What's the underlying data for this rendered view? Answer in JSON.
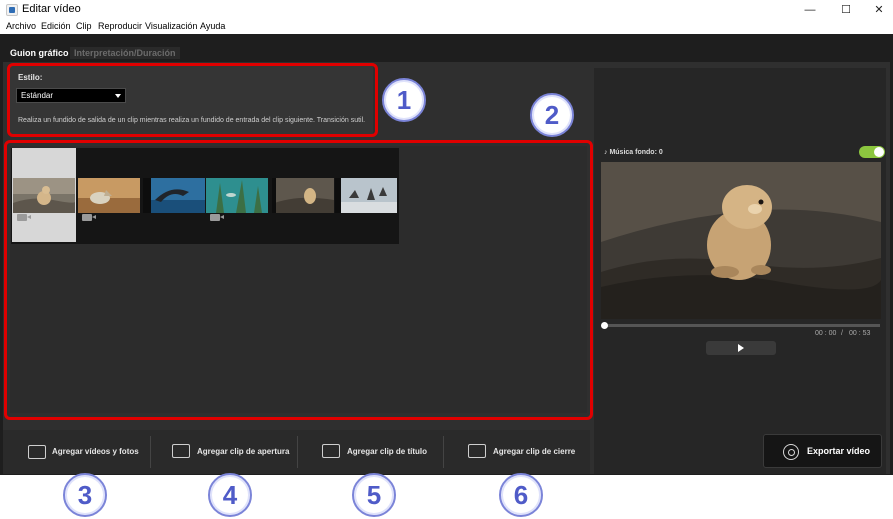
{
  "window": {
    "title": "Editar vídeo",
    "controls": [
      "minimize-icon",
      "maximize-icon",
      "close-icon"
    ]
  },
  "menu": [
    "Archivo",
    "Edición",
    "Clip",
    "Reproducir",
    "Visualización",
    "Ayuda"
  ],
  "tabs": [
    {
      "label": "Guion gráfico",
      "active": true
    },
    {
      "label": "Interpretación/Duración",
      "active": false
    }
  ],
  "style_panel": {
    "label": "Estilo:",
    "selected": "Estándar",
    "description": "Realiza un fundido de salida de un clip mientras realiza un fundido de entrada del clip siguiente. Transición sutil."
  },
  "storyboard": {
    "clips": [
      {
        "icon": "movie-camera-icon",
        "selected": true,
        "has_icon": true
      },
      {
        "icon": "movie-camera-icon",
        "selected": false,
        "has_icon": true
      },
      {
        "icon": "",
        "selected": false,
        "has_icon": false
      },
      {
        "icon": "movie-camera-icon",
        "selected": false,
        "has_icon": true
      },
      {
        "icon": "",
        "selected": false,
        "has_icon": false
      },
      {
        "icon": "",
        "selected": false,
        "has_icon": false
      }
    ]
  },
  "bottom_buttons": [
    {
      "label": "Agregar vídeos y fotos",
      "icon": "add-media-icon"
    },
    {
      "label": "Agregar clip de apertura",
      "icon": "title-clip-icon"
    },
    {
      "label": "Agregar clip de título",
      "icon": "title-clip-icon"
    },
    {
      "label": "Agregar clip de cierre",
      "icon": "title-clip-icon"
    }
  ],
  "preview": {
    "music_label": "Música fondo: 0",
    "music_enabled": true,
    "time_current": "00 : 00",
    "time_separator": "/",
    "time_total": "00 : 53",
    "progress": 0
  },
  "export": {
    "label": "Exportar vídeo",
    "icon": "export-film-icon"
  },
  "callouts": [
    "1",
    "2",
    "3",
    "4",
    "5",
    "6"
  ],
  "colors": {
    "highlight": "#e00000",
    "callout_text": "#4f5bc8",
    "toggle_on": "#8cc63f",
    "app_background": "#2f2f2f"
  }
}
